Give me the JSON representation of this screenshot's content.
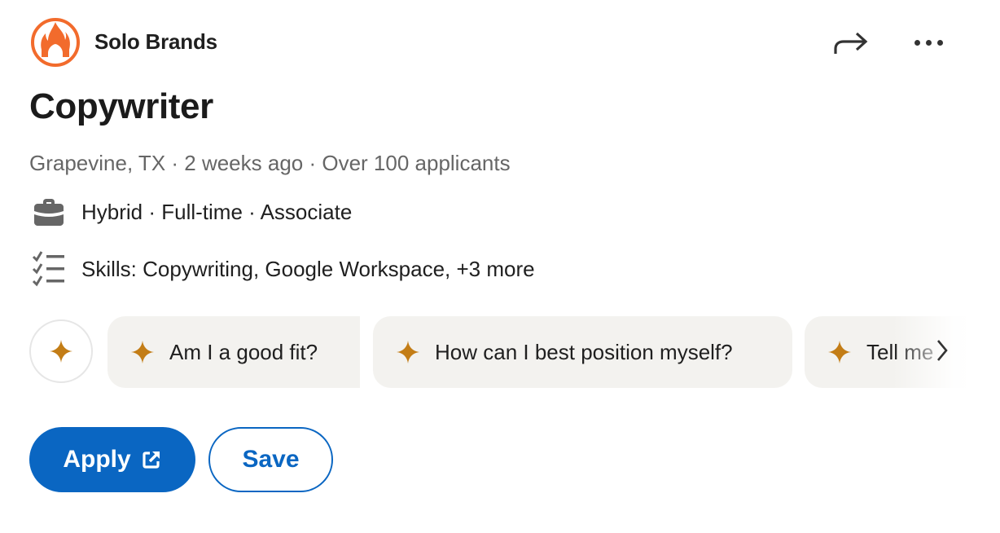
{
  "company": {
    "name": "Solo Brands",
    "logo_icon": "flame-logo",
    "logo_color": "#f26b2c"
  },
  "header_actions": {
    "share_icon": "share-arrow-icon",
    "more_icon": "more-options-icon"
  },
  "job": {
    "title": "Copywriter",
    "meta": "Grapevine, TX · 2 weeks ago · Over 100 applicants",
    "details": [
      {
        "icon": "briefcase-icon",
        "text": "Hybrid · Full-time · Associate"
      },
      {
        "icon": "checklist-icon",
        "text": "Skills: Copywriting, Google Workspace, +3 more"
      }
    ]
  },
  "ai_prompts": {
    "icon": "sparkle-icon",
    "accent_color": "#c37d16",
    "chips": [
      {
        "label": "Am I a good fit?"
      },
      {
        "label": "How can I best position myself?"
      },
      {
        "label": "Tell me"
      }
    ],
    "next_icon": "chevron-right-icon"
  },
  "actions": {
    "apply_label": "Apply",
    "apply_icon": "external-link-icon",
    "save_label": "Save",
    "brand_color": "#0a66c2"
  }
}
